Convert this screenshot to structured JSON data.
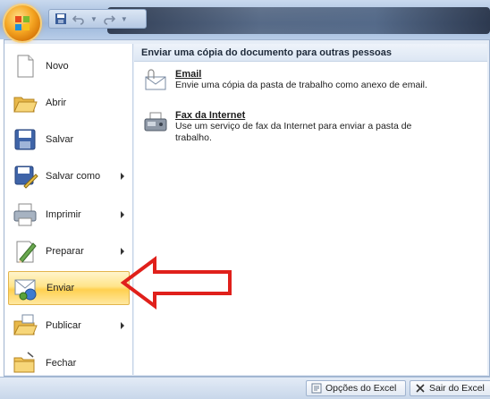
{
  "menu": {
    "items": [
      {
        "label": "Novo",
        "submenu": false,
        "icon": "new-document-icon"
      },
      {
        "label": "Abrir",
        "submenu": false,
        "icon": "open-folder-icon"
      },
      {
        "label": "Salvar",
        "submenu": false,
        "icon": "save-disk-icon"
      },
      {
        "label": "Salvar como",
        "submenu": true,
        "icon": "save-as-icon"
      },
      {
        "label": "Imprimir",
        "submenu": true,
        "icon": "printer-icon"
      },
      {
        "label": "Preparar",
        "submenu": true,
        "icon": "prepare-icon"
      },
      {
        "label": "Enviar",
        "submenu": true,
        "active": true,
        "icon": "send-icon"
      },
      {
        "label": "Publicar",
        "submenu": true,
        "icon": "publish-icon"
      },
      {
        "label": "Fechar",
        "submenu": false,
        "icon": "close-folder-icon"
      }
    ]
  },
  "right_pane": {
    "header": "Enviar uma cópia do documento para outras pessoas",
    "items": [
      {
        "title": "Email",
        "description": "Envie uma cópia da pasta de trabalho como anexo de email.",
        "icon": "email-icon"
      },
      {
        "title": "Fax da Internet",
        "description": "Use um serviço de fax da Internet para enviar a pasta de trabalho.",
        "icon": "fax-icon"
      }
    ]
  },
  "bottom_bar": {
    "options_label": "Opções do Excel",
    "exit_label": "Sair do Excel"
  },
  "colors": {
    "active_highlight": "#ffd04f",
    "annotation_arrow": "#e0201b",
    "office_button": "#f5a623"
  }
}
